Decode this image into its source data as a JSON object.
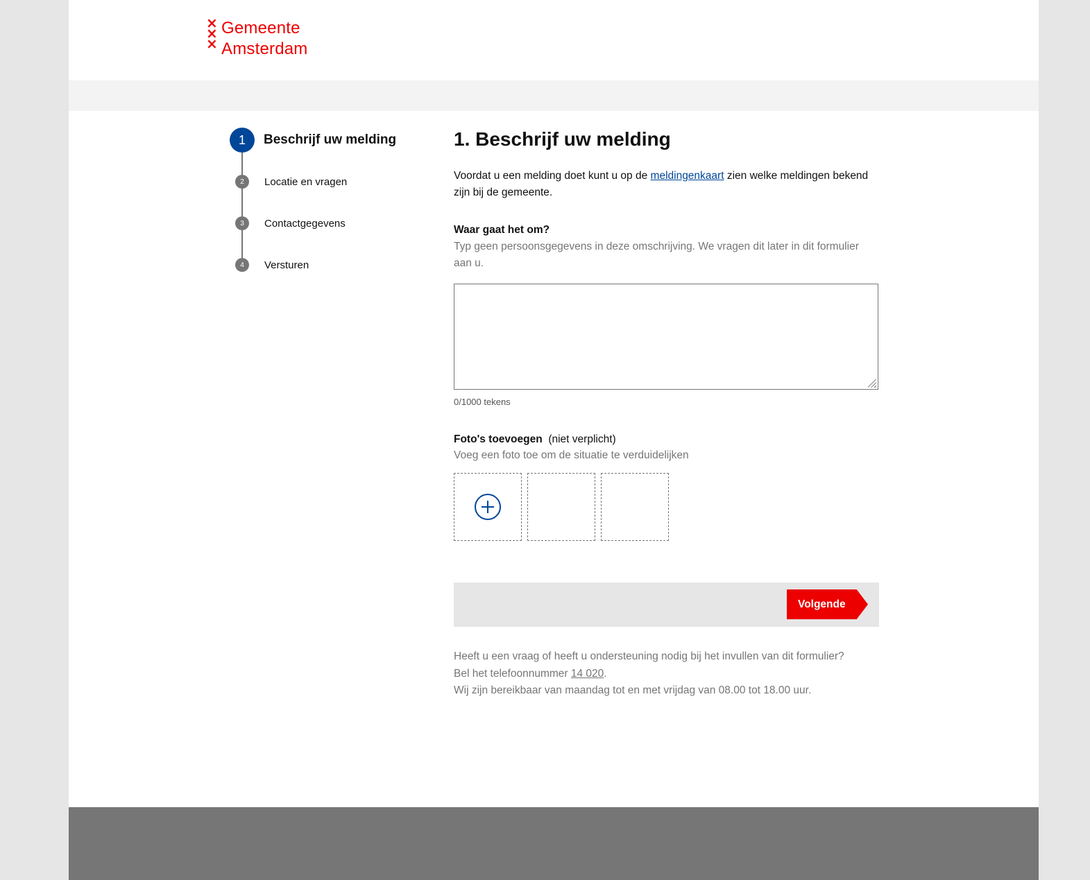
{
  "header": {
    "logo_line1": "Gemeente",
    "logo_line2": "Amsterdam",
    "logo_cross": "×",
    "brand_color": "#ec0000"
  },
  "stepper": {
    "steps": [
      {
        "number": "1",
        "label": "Beschrijf uw melding",
        "active": true
      },
      {
        "number": "2",
        "label": "Locatie en vragen",
        "active": false
      },
      {
        "number": "3",
        "label": "Contactgegevens",
        "active": false
      },
      {
        "number": "4",
        "label": "Versturen",
        "active": false
      }
    ],
    "active_color": "#004699"
  },
  "main": {
    "title": "1. Beschrijf uw melding",
    "intro_before": "Voordat u een melding doet kunt u op de ",
    "intro_link": "meldingenkaart",
    "intro_after": " zien welke meldingen bekend zijn bij de gemeente.",
    "question_label": "Waar gaat het om?",
    "question_hint": "Typ geen persoonsgegevens in deze omschrijving. We vragen dit later in dit formulier aan u.",
    "description_value": "",
    "char_counter": "0/1000 tekens",
    "photo_label": "Foto's toevoegen",
    "photo_optional": "(niet verplicht)",
    "photo_hint": "Voeg een foto toe om de situatie te verduidelijken",
    "add_photo_icon": "plus-circle-icon",
    "next_button": "Volgende",
    "help_line1": "Heeft u een vraag of heeft u ondersteuning nodig bij het invullen van dit formulier?",
    "help_line2_before": "Bel het telefoonnummer ",
    "help_phone": "14 020",
    "help_line2_after": ".",
    "help_line3": "Wij zijn bereikbaar van maandag tot en met vrijdag van 08.00 tot 18.00 uur."
  }
}
